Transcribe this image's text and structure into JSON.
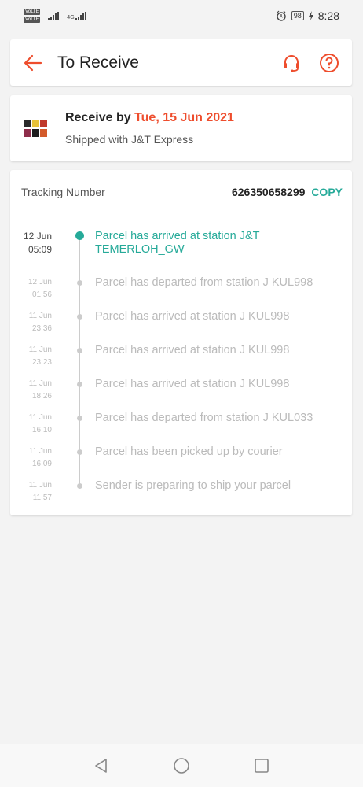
{
  "status_bar": {
    "network_badges": [
      "VoLTE",
      "VoLTE"
    ],
    "network_type": "4G",
    "battery": "98",
    "time": "8:28"
  },
  "header": {
    "title": "To Receive",
    "back_icon": "arrow-left-icon",
    "support_icon": "headset-icon",
    "help_icon": "question-circle-icon"
  },
  "receive": {
    "label": "Receive by",
    "date": "Tue, 15 Jun 2021",
    "shipped": "Shipped with J&T Express"
  },
  "tracking": {
    "label": "Tracking Number",
    "number": "626350658299",
    "copy": "COPY",
    "events": [
      {
        "date": "12 Jun",
        "time": "05:09",
        "text": "Parcel has arrived at station J&T TEMERLOH_GW",
        "active": true
      },
      {
        "date": "12 Jun",
        "time": "01:56",
        "text": "Parcel has departed from station J KUL998"
      },
      {
        "date": "11 Jun",
        "time": "23:36",
        "text": "Parcel has arrived at station J KUL998"
      },
      {
        "date": "11 Jun",
        "time": "23:23",
        "text": "Parcel has arrived at station J KUL998"
      },
      {
        "date": "11 Jun",
        "time": "18:26",
        "text": "Parcel has arrived at station J KUL998"
      },
      {
        "date": "11 Jun",
        "time": "16:10",
        "text": "Parcel has departed from station J KUL033"
      },
      {
        "date": "11 Jun",
        "time": "16:09",
        "text": "Parcel has been picked up by courier"
      },
      {
        "date": "11 Jun",
        "time": "11:57",
        "text": "Sender is preparing to ship your parcel"
      }
    ]
  },
  "colors": {
    "accent": "#ee4d2d",
    "teal": "#26aa99"
  }
}
